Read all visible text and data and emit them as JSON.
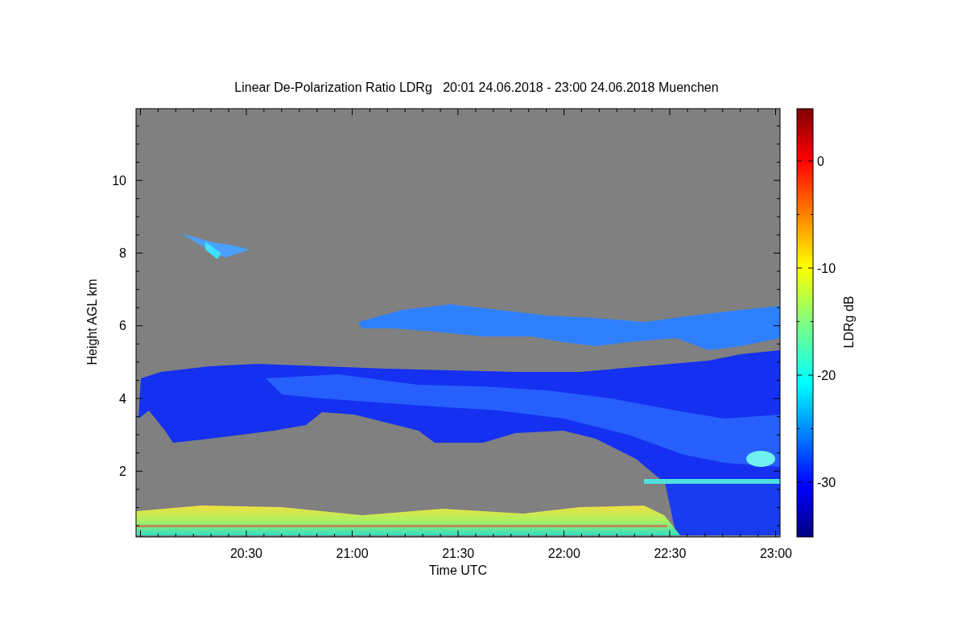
{
  "title": "Linear De-Polarization Ratio LDRg   20:01 24.06.2018 - 23:00 24.06.2018 Muenchen",
  "y_axis": {
    "label": "Height AGL km",
    "ticks": [
      "10",
      "8",
      "6",
      "4",
      "2"
    ]
  },
  "x_axis": {
    "label": "Time UTC",
    "ticks": [
      "20:30",
      "21:00",
      "21:30",
      "22:00",
      "22:30",
      "23:00"
    ]
  },
  "colorbar": {
    "label": "LDRg dB",
    "ticks": [
      "0",
      "-10",
      "-20",
      "-30"
    ]
  }
}
